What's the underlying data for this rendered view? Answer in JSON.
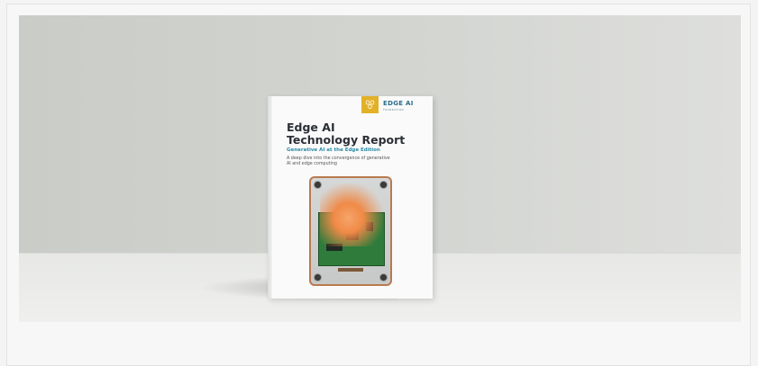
{
  "banner": {
    "brand_logo": "gold-hex-logo",
    "brand_name": "EDGE AI",
    "brand_sub": "FOUNDATION",
    "book_title_line1": "Edge AI",
    "book_title_line2": "Technology Report",
    "book_subtitle": "Generative AI at the Edge Edition",
    "book_description": "A deep dive into the convergence of generative AI and edge computing"
  },
  "colors": {
    "accent_teal": "#2a8ca8",
    "logo_gold": "#e2b128",
    "device_copper": "#b97a4f"
  }
}
